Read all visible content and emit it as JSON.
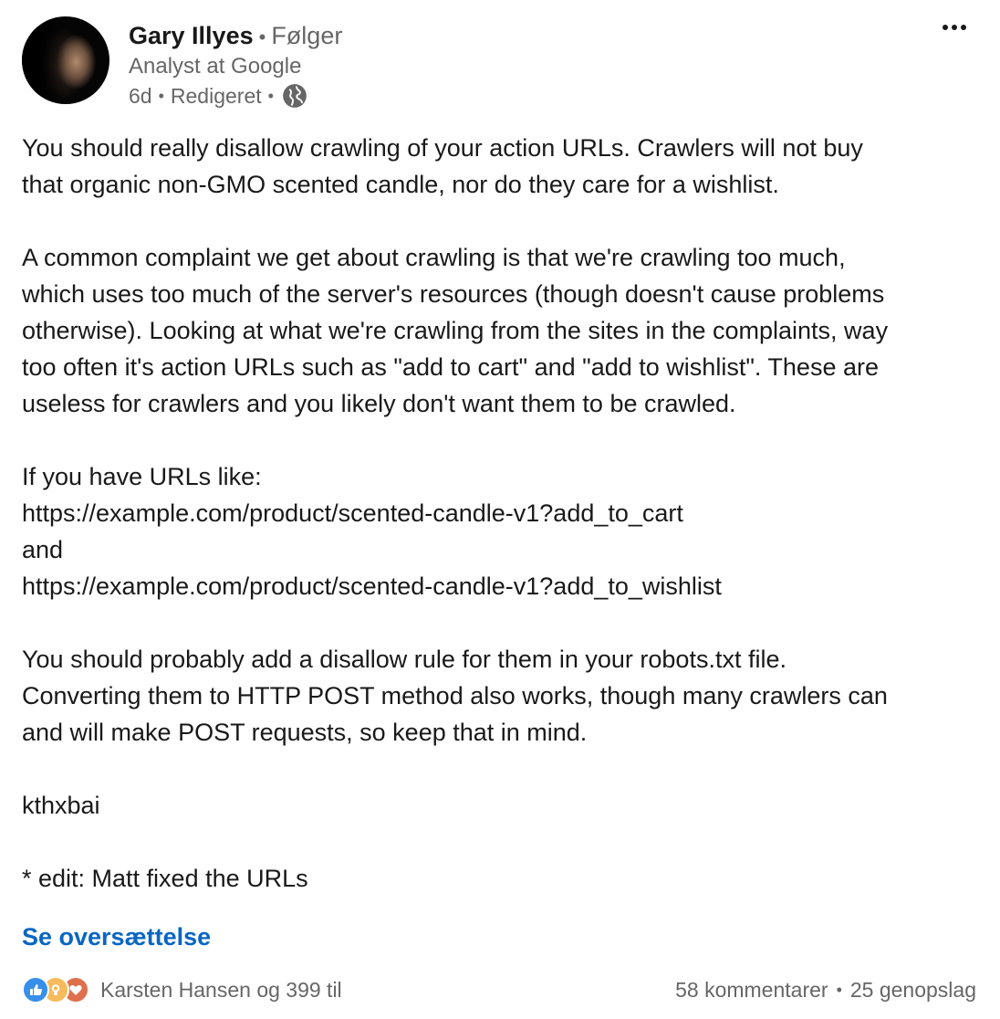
{
  "author": {
    "name": "Gary Illyes",
    "separator": "•",
    "follow_status": "Følger",
    "headline": "Analyst at Google",
    "time": "6d",
    "edited": "Redigeret"
  },
  "post": {
    "paragraphs": [
      [
        "You should really disallow crawling of your action URLs. Crawlers will not buy",
        "that organic non-GMO scented candle, nor do they care for a wishlist."
      ],
      [
        "A common complaint we get about crawling is that we're crawling too much,",
        "which uses too much of the server's resources (though doesn't cause problems",
        "otherwise). Looking at what we're crawling from the sites in the complaints, way",
        "too often it's action URLs such as \"add to cart\" and \"add to wishlist\". These are",
        "useless for crawlers and you likely don't want them to be crawled."
      ],
      [
        "If you have URLs like:",
        "https://example.com/product/scented-candle-v1?add_to_cart",
        "and",
        "https://example.com/product/scented-candle-v1?add_to_wishlist"
      ],
      [
        "You should probably add a disallow rule for them in your robots.txt file.",
        "Converting them to HTTP POST method also works, though many crawlers can",
        "and will make POST requests, so keep that in mind."
      ],
      [
        "kthxbai"
      ],
      [
        "* edit: Matt fixed the URLs"
      ]
    ]
  },
  "translate_label": "Se oversættelse",
  "social": {
    "reactions": [
      "like-icon",
      "insightful-icon",
      "love-icon"
    ],
    "reactors": "Karsten Hansen og 399 til",
    "comments": "58 kommentarer",
    "reposts": "25 genopslag"
  },
  "colors": {
    "link": "#0a66c2",
    "secondary_text": "#666666",
    "like": "#378fe9",
    "insightful": "#f5bb5c",
    "love": "#df704d"
  }
}
